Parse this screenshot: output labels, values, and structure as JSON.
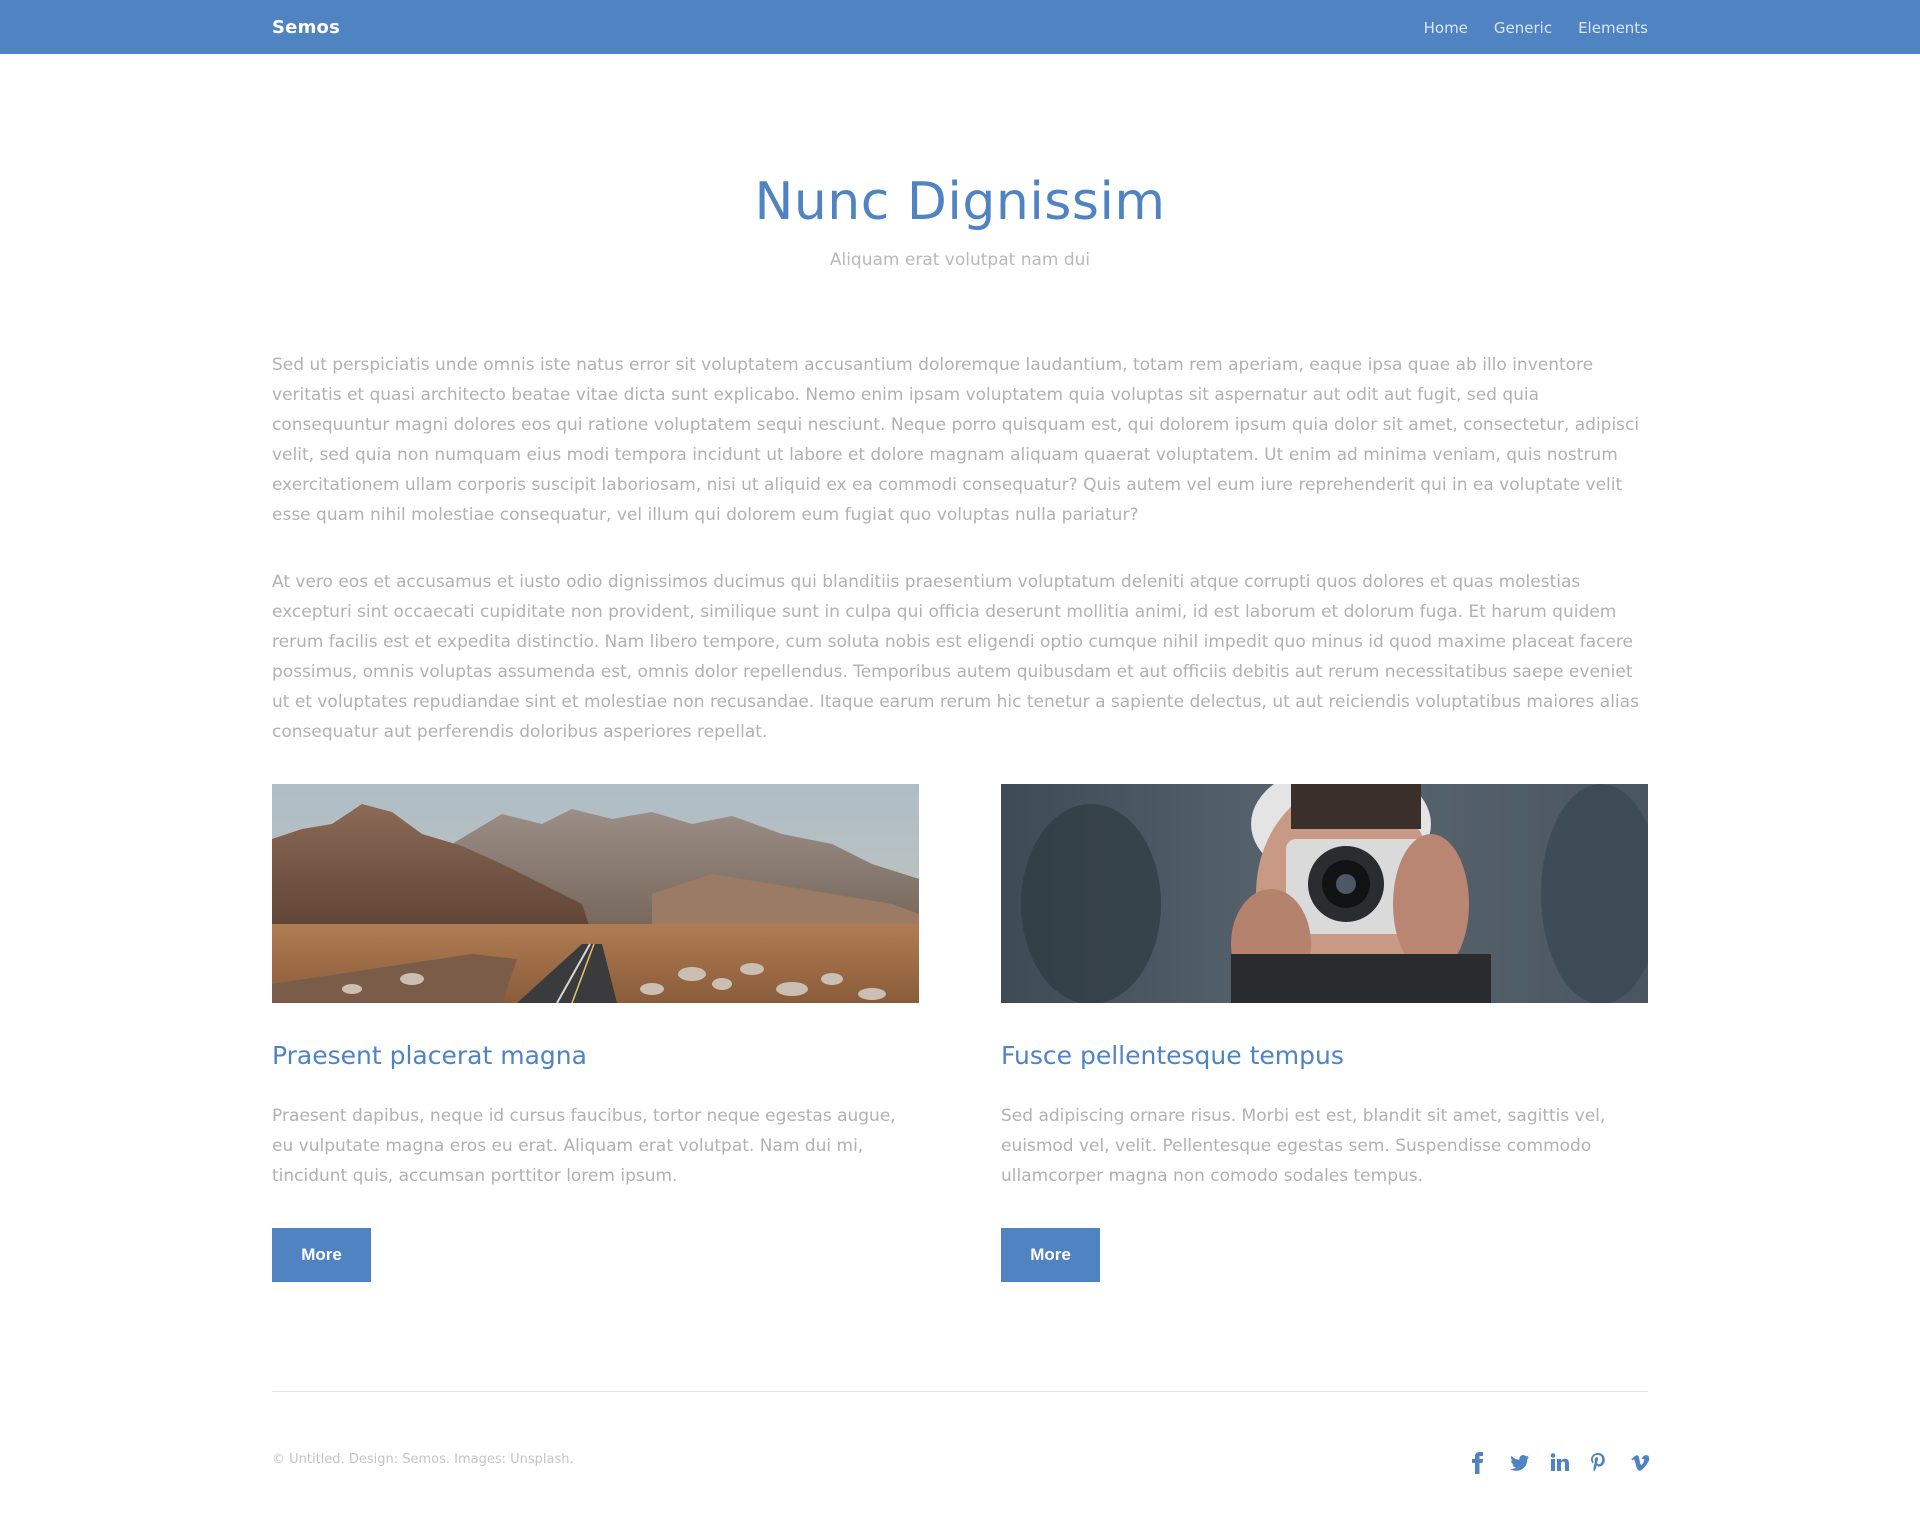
{
  "header": {
    "brand": "Semos",
    "nav": [
      "Home",
      "Generic",
      "Elements"
    ]
  },
  "hero": {
    "title": "Nunc Dignissim",
    "subtitle": "Aliquam erat volutpat nam dui"
  },
  "body": {
    "paragraph1": "Sed ut perspiciatis unde omnis iste natus error sit voluptatem accusantium doloremque laudantium, totam rem aperiam, eaque ipsa quae ab illo inventore veritatis et quasi architecto beatae vitae dicta sunt explicabo. Nemo enim ipsam voluptatem quia voluptas sit aspernatur aut odit aut fugit, sed quia consequuntur magni dolores eos qui ratione voluptatem sequi nesciunt. Neque porro quisquam est, qui dolorem ipsum quia dolor sit amet, consectetur, adipisci velit, sed quia non numquam eius modi tempora incidunt ut labore et dolore magnam aliquam quaerat voluptatem. Ut enim ad minima veniam, quis nostrum exercitationem ullam corporis suscipit laboriosam, nisi ut aliquid ex ea commodi consequatur? Quis autem vel eum iure reprehenderit qui in ea voluptate velit esse quam nihil molestiae consequatur, vel illum qui dolorem eum fugiat quo voluptas nulla pariatur?",
    "paragraph2": "At vero eos et accusamus et iusto odio dignissimos ducimus qui blanditiis praesentium voluptatum deleniti atque corrupti quos dolores et quas molestias excepturi sint occaecati cupiditate non provident, similique sunt in culpa qui officia deserunt mollitia animi, id est laborum et dolorum fuga. Et harum quidem rerum facilis est et expedita distinctio. Nam libero tempore, cum soluta nobis est eligendi optio cumque nihil impedit quo minus id quod maxime placeat facere possimus, omnis voluptas assumenda est, omnis dolor repellendus. Temporibus autem quibusdam et aut officiis debitis aut rerum necessitatibus saepe eveniet ut et voluptates repudiandae sint et molestiae non recusandae. Itaque earum rerum hic tenetur a sapiente delectus, ut aut reiciendis voluptatibus maiores alias consequatur aut perferendis doloribus asperiores repellat."
  },
  "cards": [
    {
      "title": "Praesent placerat magna",
      "text": "Praesent dapibus, neque id cursus faucibus, tortor neque egestas augue, eu vulputate magna eros eu erat. Aliquam erat volutpat. Nam dui mi, tincidunt quis, accumsan porttitor lorem ipsum.",
      "button": "More"
    },
    {
      "title": "Fusce pellentesque tempus",
      "text": "Sed adipiscing ornare risus. Morbi est est, blandit sit amet, sagittis vel, euismod vel, velit. Pellentesque egestas sem. Suspendisse commodo ullamcorper magna non comodo sodales tempus.",
      "button": "More"
    }
  ],
  "footer": {
    "copyright": "© Untitled. Design: Semos. Images: Unsplash.",
    "social_icons": [
      "facebook-icon",
      "twitter-icon",
      "linkedin-icon",
      "pinterest-icon",
      "vimeo-icon"
    ]
  },
  "colors": {
    "accent": "#4f83c2",
    "text": "#b1b1b1"
  }
}
